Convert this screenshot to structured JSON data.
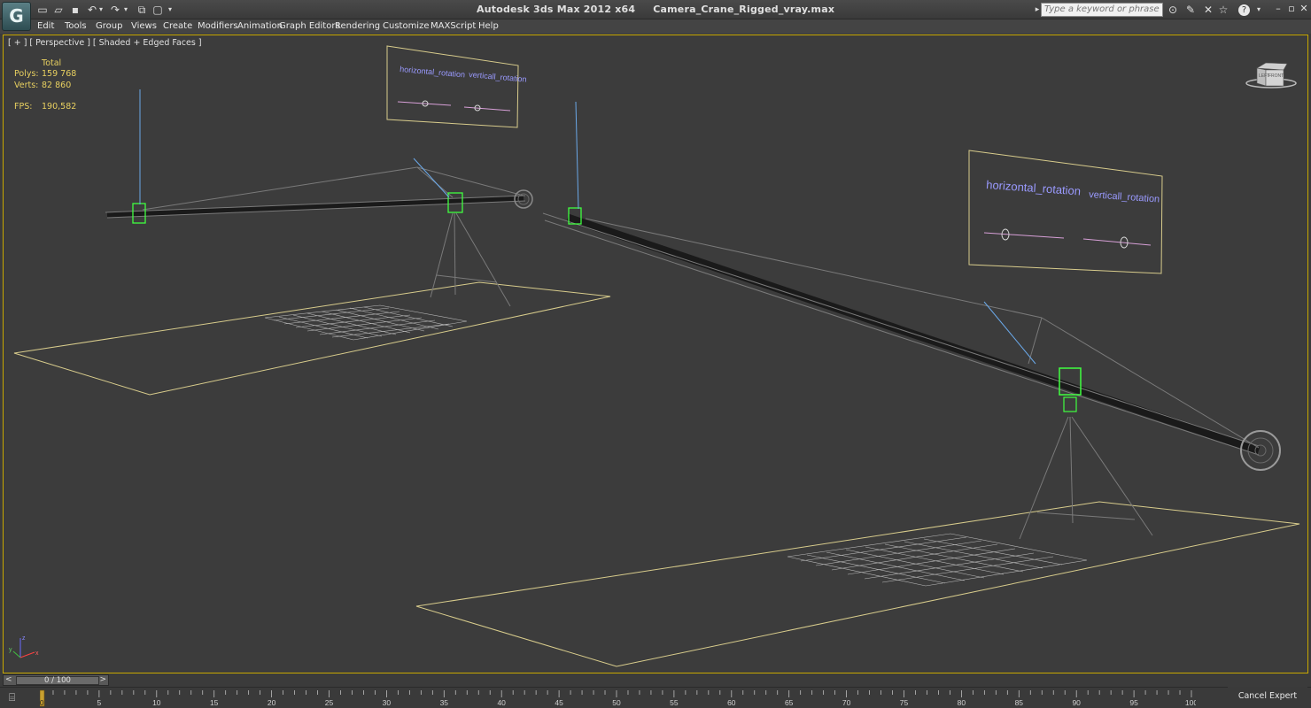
{
  "window": {
    "app_name": "Autodesk 3ds Max  2012 x64",
    "file_name": "Camera_Crane_Rigged_vray.max",
    "search_placeholder": "Type a keyword or phrase",
    "help_icon": "?"
  },
  "menu": [
    "Edit",
    "Tools",
    "Group",
    "Views",
    "Create",
    "Modifiers",
    "Animation",
    "Graph Editors",
    "Rendering",
    "Customize",
    "MAXScript",
    "Help"
  ],
  "viewport": {
    "label": "[ + ] [ Perspective ] [ Shaded + Edged Faces ]",
    "stats": {
      "total_label": "Total",
      "polys_label": "Polys:",
      "polys_value": "159 768",
      "verts_label": "Verts:",
      "verts_value": "82 860",
      "fps_label": "FPS:",
      "fps_value": "190,582"
    },
    "viewcube": {
      "left_label": "LEFT",
      "front_label": "FRONT"
    },
    "panel_left": {
      "h_label": "horizontal_rotation",
      "v_label": "verticall_rotation"
    },
    "panel_right": {
      "h_label": "horizontal_rotation",
      "v_label": "verticall_rotation"
    },
    "axis": {
      "x": "x",
      "y": "y",
      "z": "z"
    }
  },
  "timeline": {
    "frame_display": "0 / 100",
    "prev": "<",
    "next": ">",
    "ticks": [
      "5",
      "10",
      "15",
      "20",
      "25",
      "30",
      "35",
      "40",
      "45",
      "50",
      "55",
      "60",
      "65",
      "70",
      "75",
      "80",
      "85",
      "90",
      "95",
      "100"
    ],
    "start_marker": "0",
    "current_frame": 0,
    "total_frames": 100
  },
  "cancel_expert_mode": "Cancel Expert Mode",
  "colors": {
    "viewport_bg": "#3c3c3c",
    "selection_green": "#40ff40",
    "helper_blue": "#6aa8e8",
    "grid_yellow": "#d8cc8c",
    "panel_text": "#9a9aff"
  }
}
